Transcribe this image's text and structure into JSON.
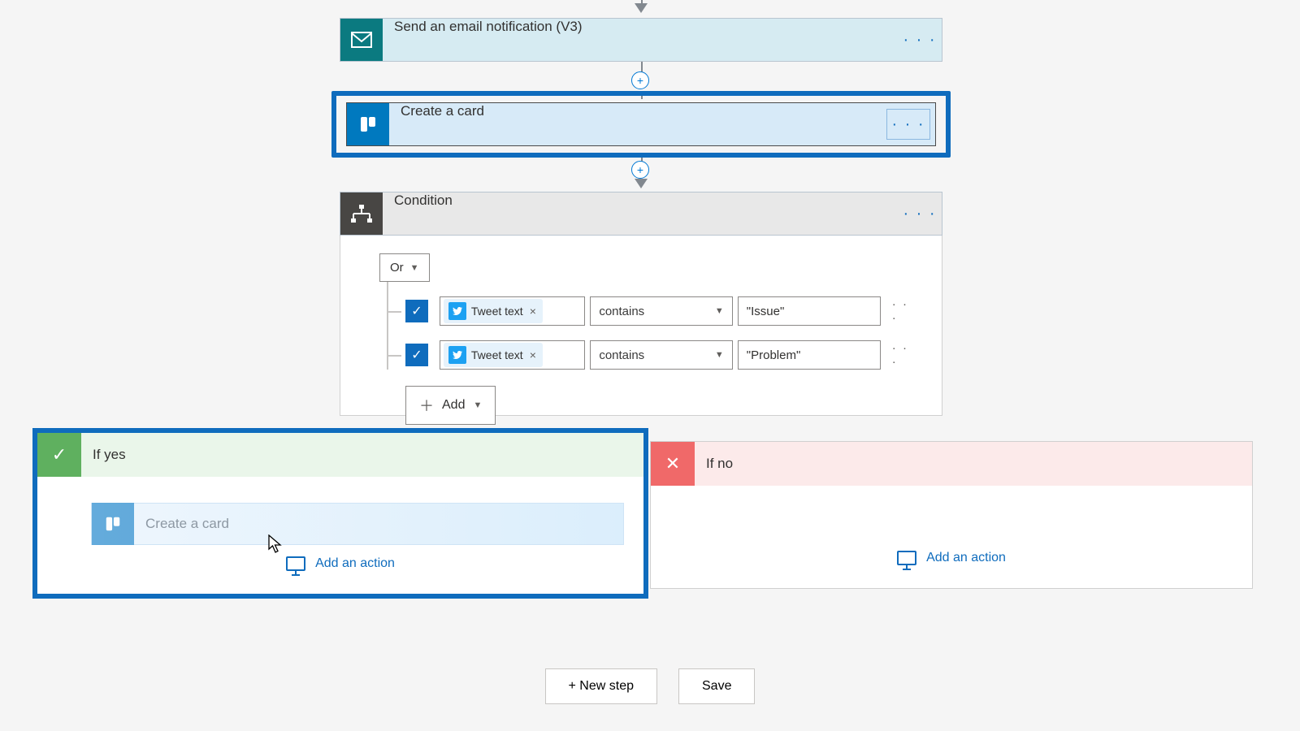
{
  "steps": {
    "email": {
      "title": "Send an email notification (V3)"
    },
    "trello": {
      "title": "Create a card"
    },
    "condition": {
      "title": "Condition",
      "group": "Or",
      "add": "Add",
      "rules": [
        {
          "token": "Tweet text",
          "operator": "contains",
          "value": "\"Issue\""
        },
        {
          "token": "Tweet text",
          "operator": "contains",
          "value": "\"Problem\""
        }
      ]
    }
  },
  "branches": {
    "yes": {
      "title": "If yes",
      "ghost_title": "Create a card",
      "add_action": "Add an action"
    },
    "no": {
      "title": "If no",
      "add_action": "Add an action"
    }
  },
  "footer": {
    "new_step": "+ New step",
    "save": "Save"
  }
}
